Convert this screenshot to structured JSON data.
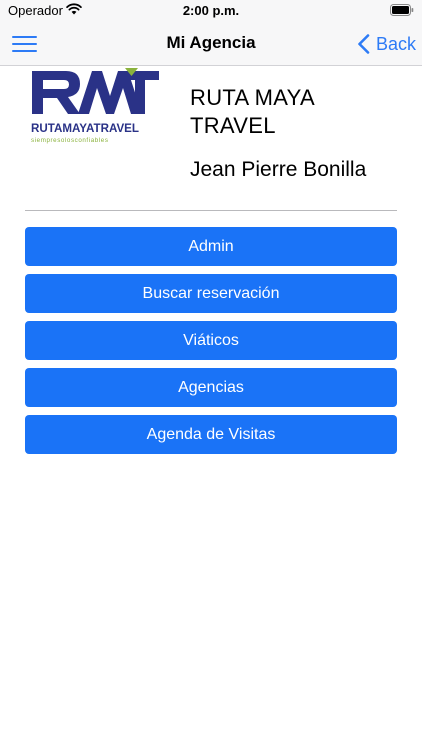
{
  "status_bar": {
    "carrier": "Operador",
    "time": "2:00 p.m."
  },
  "nav": {
    "title": "Mi Agencia",
    "back_label": "Back",
    "accent_color": "#2d7bf6"
  },
  "header": {
    "logo_wordmark": "RUTAMAYATRAVEL",
    "logo_tagline": "siempresolosconfiables",
    "agency_name": "RUTA MAYA TRAVEL",
    "agent_name": "Jean Pierre Bonilla"
  },
  "menu": {
    "button_color": "#1a73f7",
    "items": [
      {
        "label": "Admin"
      },
      {
        "label": "Buscar reservación"
      },
      {
        "label": "Viáticos"
      },
      {
        "label": "Agencias"
      },
      {
        "label": "Agenda de Visitas"
      }
    ]
  },
  "icons": [
    "wifi-icon",
    "battery-icon",
    "hamburger-menu-icon",
    "chevron-left-icon",
    "agency-logo"
  ]
}
